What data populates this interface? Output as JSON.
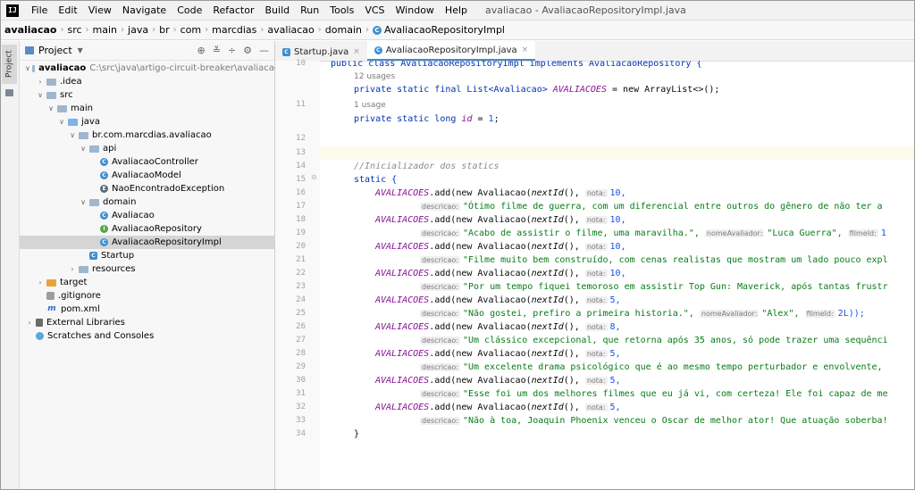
{
  "app": {
    "logo": "IJ",
    "menu": [
      "File",
      "Edit",
      "View",
      "Navigate",
      "Code",
      "Refactor",
      "Build",
      "Run",
      "Tools",
      "VCS",
      "Window",
      "Help"
    ],
    "window_title": "avaliacao - AvaliacaoRepositoryImpl.java"
  },
  "breadcrumb": [
    "avaliacao",
    "src",
    "main",
    "java",
    "br",
    "com",
    "marcdias",
    "avaliacao",
    "domain",
    "AvaliacaoRepositoryImpl"
  ],
  "strip": {
    "project_tab": "Project"
  },
  "project_panel": {
    "title": "Project",
    "tree": [
      {
        "name": "avaliacao",
        "hint": "C:\\src\\java\\artigo-circuit-breaker\\avaliacao"
      },
      {
        "name": ".idea"
      },
      {
        "name": "src"
      },
      {
        "name": "main"
      },
      {
        "name": "java"
      },
      {
        "name": "br.com.marcdias.avaliacao"
      },
      {
        "name": "api"
      },
      {
        "name": "AvaliacaoController"
      },
      {
        "name": "AvaliacaoModel"
      },
      {
        "name": "NaoEncontradoException"
      },
      {
        "name": "domain"
      },
      {
        "name": "Avaliacao"
      },
      {
        "name": "AvaliacaoRepository"
      },
      {
        "name": "AvaliacaoRepositoryImpl"
      },
      {
        "name": "Startup"
      },
      {
        "name": "resources"
      },
      {
        "name": "target"
      },
      {
        "name": ".gitignore"
      },
      {
        "name": "pom.xml"
      },
      {
        "name": "External Libraries"
      },
      {
        "name": "Scratches and Consoles"
      }
    ]
  },
  "editor": {
    "tabs": [
      "Startup.java",
      "AvaliacaoRepositoryImpl.java"
    ],
    "line_numbers": [
      "10",
      "11",
      "12",
      "13",
      "14",
      "15",
      "16",
      "17",
      "18",
      "19",
      "20",
      "21",
      "22",
      "23",
      "24",
      "25",
      "26",
      "27",
      "28",
      "29",
      "30",
      "31",
      "32",
      "33",
      "34"
    ],
    "code": {
      "l10": "public class AvaliacaoRepositoryImpl implements AvaliacaoRepository {",
      "usages12": "12 usages",
      "l11_a": "private static final List<Avaliacao> ",
      "l11_b": "AVALIACOES",
      "l11_c": " = new ArrayList<>();",
      "usage1": "1 usage",
      "l12_a": "private static long ",
      "l12_b": "id",
      "l12_c": " = ",
      "l12_d": "1",
      "l12_e": ";",
      "l14": "//Inicializador dos statics",
      "l15": "static {",
      "add_prefix": "AVALIACOES",
      "add_mid": ".add(new Avaliacao(",
      "next_id": "nextId",
      "after_id": "(),",
      "hint_nota": "nota:",
      "hint_desc": "descricao:",
      "hint_nome": "nomeAvaliador:",
      "hint_filme": "filmeId:",
      "n16": "10,",
      "s17": "\"Ótimo filme de guerra, com um diferencial entre outros do gênero de não ter a",
      "n18": "10,",
      "s19": "\"Acabo de assistir o filme, uma maravilha.\",",
      "s19_nome": "\"Luca Guerra\",",
      "s19_filme": "1",
      "n20": "10,",
      "s21": "\"Filme muito bem construído, com cenas realistas que mostram um lado pouco expl",
      "n22": "10,",
      "s23": "\"Por um tempo fiquei temoroso em assistir Top Gun: Maverick, após tantas frustr",
      "n24": "5,",
      "s25": "\"Não gostei, prefiro a primeira historia.\",",
      "s25_nome": "\"Alex\",",
      "s25_filme": "2L));",
      "n26": "8,",
      "s27": "\"Um clássico excepcional, que retorna após 35 anos, só pode trazer uma sequênci",
      "n28": "5,",
      "s29": "\"Um excelente drama psicológico que é ao mesmo tempo perturbador e envolvente,",
      "n30": "5,",
      "s31": "\"Esse foi um dos melhores filmes que eu já vi, com certeza! Ele foi capaz de me",
      "n32": "5,",
      "s33": "\"Não à toa, Joaquin Phoenix venceu o Oscar de melhor ator! Que atuação soberba!",
      "l34": "}"
    }
  }
}
